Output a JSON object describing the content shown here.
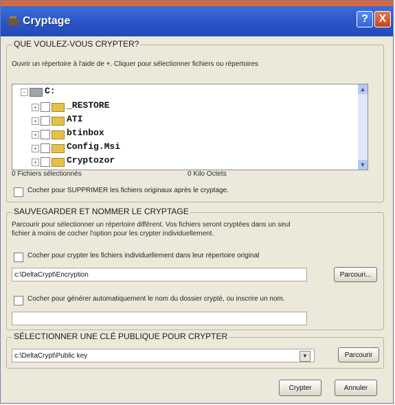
{
  "window": {
    "title": "Cryptage",
    "help": "?",
    "close": "X"
  },
  "group1": {
    "label": "QUE VOULEZ-VOUS CRYPTER?",
    "instruction": "Ouvrir un répertoire à l'aide de +. Cliquer pour sélectionner fichiers ou répertoires",
    "tree": {
      "root": "C:",
      "items": [
        "_RESTORE",
        "ATI",
        "btinbox",
        "Config.Msi",
        "Cryptozor"
      ]
    },
    "status": {
      "selected": "0 Fichiers sélectionnés",
      "size": "0 Kilo Octets"
    },
    "delete_checkbox": "Cocher pour SUPPRIMER les fichiers originaux après le cryptage."
  },
  "group2": {
    "label": "SAUVEGARDER ET NOMMER LE CRYPTAGE",
    "help1": "Parcourir pour sélectionner un répertoire différent. Vos fichiers seront cryptées dans un seul",
    "help2": "fichier à moins de cocher l'option pour les crypter individuellement.",
    "individual_checkbox": "Cocher pour crypter les fichiers individuellement dans leur répertoire original",
    "path": "c:\\DeltaCrypt\\Encryption",
    "browse": "Parcouri...",
    "auto_name_checkbox": "Cocher pour générer automatiquement le nom du dossier crypté, ou inscrire un nom.",
    "name_value": ""
  },
  "group3": {
    "label": "SÉLECTIONNER UNE CLÉ PUBLIQUE POUR CRYPTER",
    "key_path": "c:\\DeltaCrypt\\Public key",
    "browse": "Parcourir"
  },
  "footer": {
    "ok": "Crypter",
    "cancel": "Annuler"
  },
  "icons": {
    "scroll_up": "scroll-up-icon",
    "scroll_down": "scroll-down-icon",
    "dropdown": "chevron-down-icon"
  }
}
